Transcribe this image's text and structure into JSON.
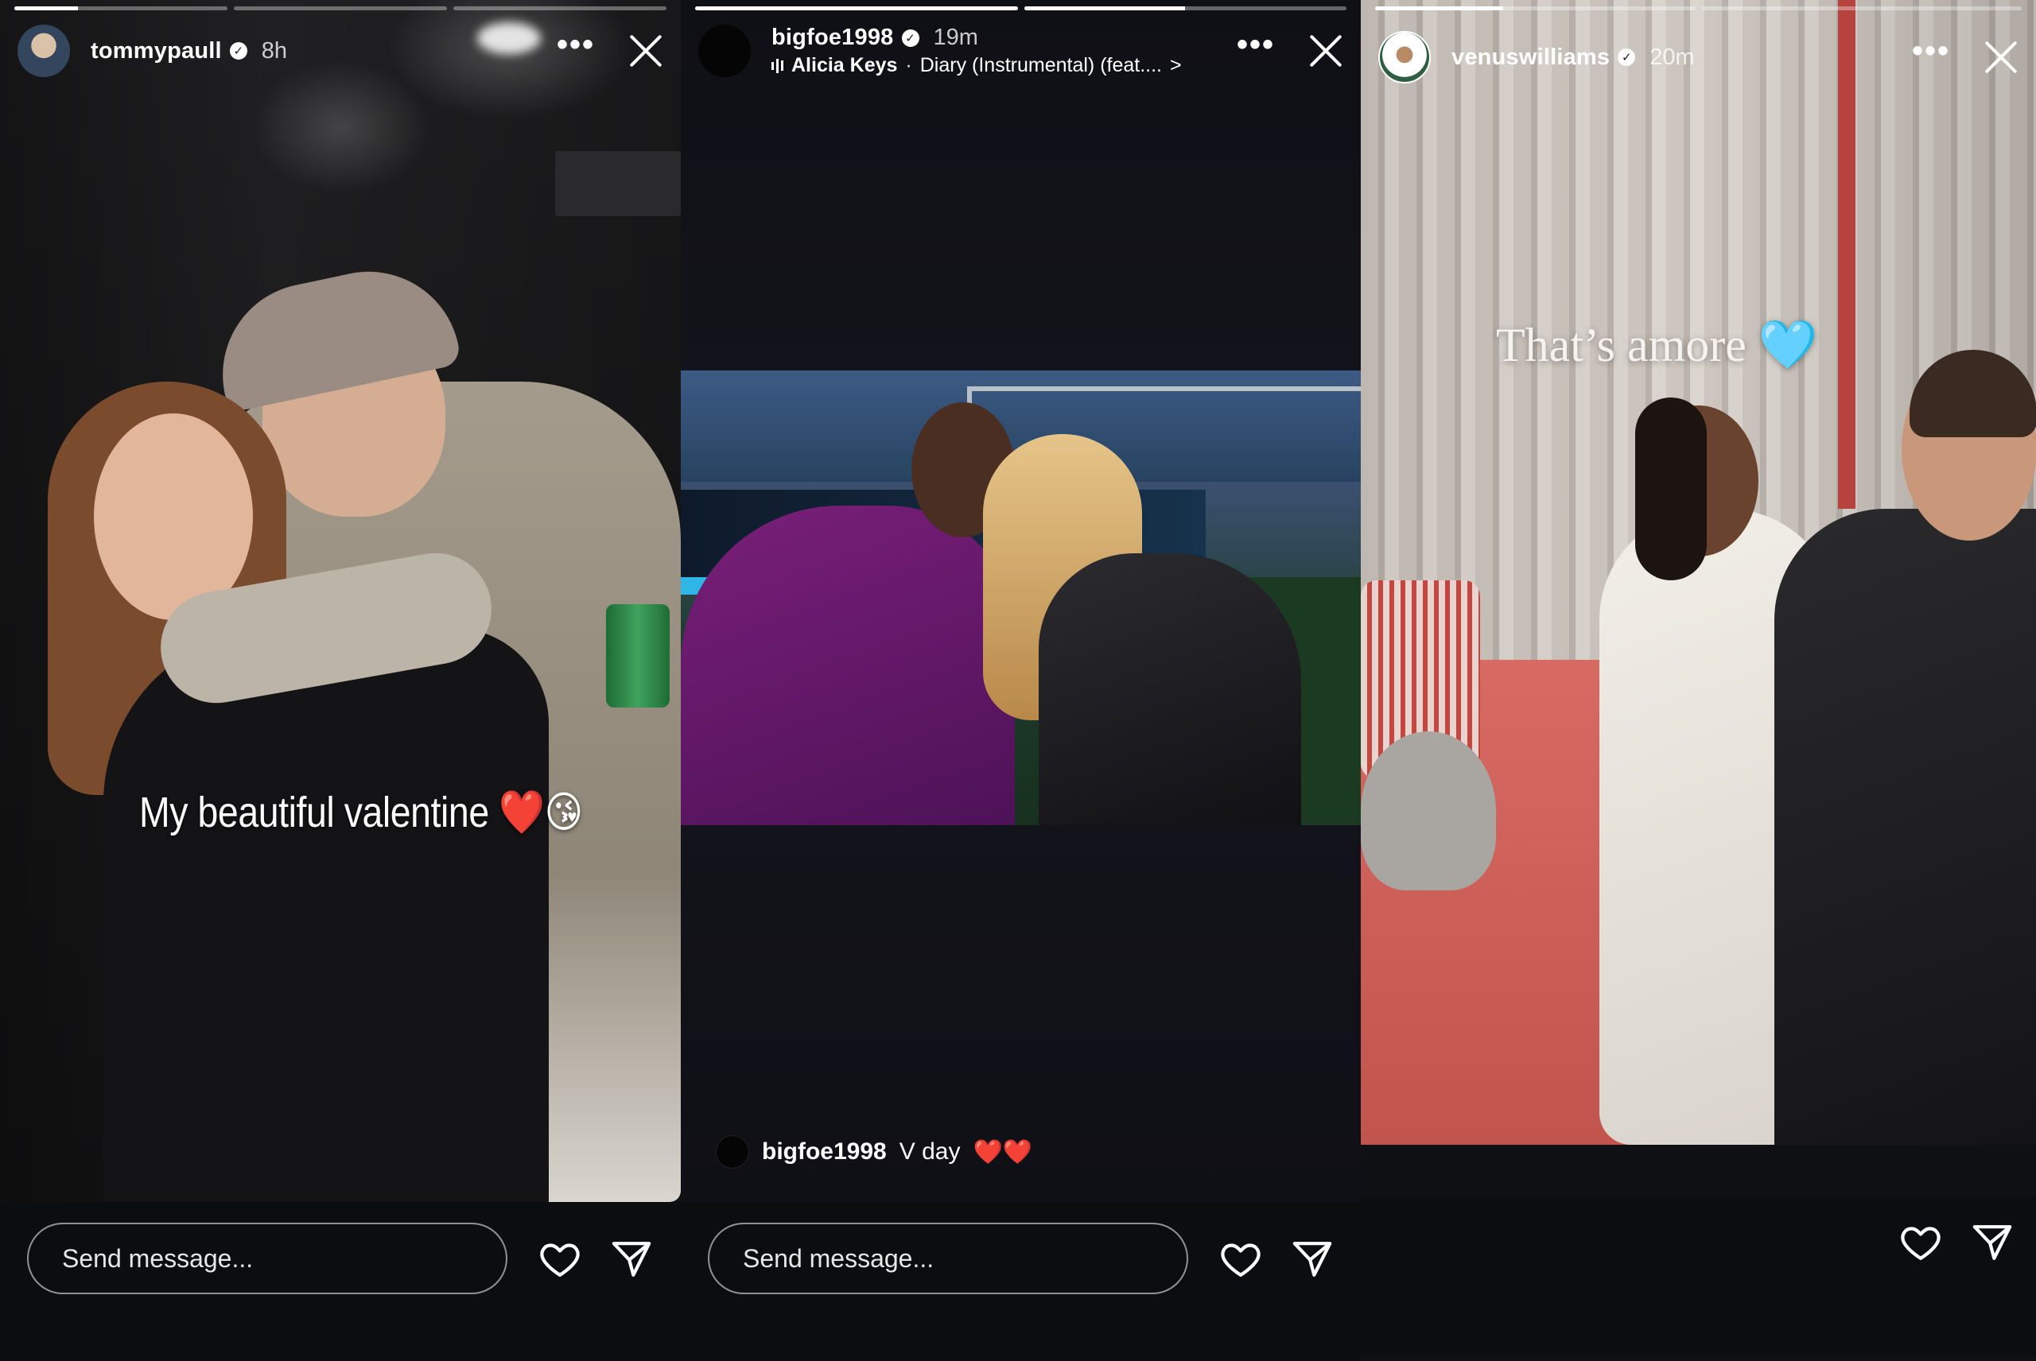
{
  "stories": [
    {
      "id": "story-1",
      "progress": [
        0.3,
        0,
        0
      ],
      "username": "tommypaull",
      "verified": true,
      "time": "8h",
      "caption": "My beautiful valentine",
      "caption_emoji": "❤️😘",
      "message_placeholder": "Send message...",
      "icons": [
        "more-icon",
        "close-icon",
        "heart-icon",
        "send-icon"
      ]
    },
    {
      "id": "story-2",
      "progress": [
        1,
        0.5
      ],
      "username": "bigfoe1998",
      "verified": true,
      "time": "19m",
      "music_artist": "Alicia Keys",
      "music_separator": "·",
      "music_title": "Diary (Instrumental) (feat....",
      "music_chevron": ">",
      "caption_user": "bigfoe1998",
      "caption_text": "V day",
      "caption_emoji": "❤️❤️",
      "message_placeholder": "Send message...",
      "icons": [
        "music-bars-icon",
        "more-icon",
        "close-icon",
        "heart-icon",
        "send-icon"
      ]
    },
    {
      "id": "story-3",
      "progress": [
        0.4,
        0
      ],
      "username": "venuswilliams",
      "verified": true,
      "time": "20m",
      "caption": "That’s amore",
      "caption_emoji": "🩵",
      "icons": [
        "more-icon",
        "close-icon",
        "heart-icon",
        "send-icon"
      ]
    }
  ],
  "colors": {
    "background": "#0f1014",
    "text": "#ffffff",
    "heart_emoji": "#e0242e",
    "light_blue_heart": "#5fc8f2"
  },
  "ui": {
    "more_glyph": "•••",
    "verified_glyph": "✓"
  }
}
